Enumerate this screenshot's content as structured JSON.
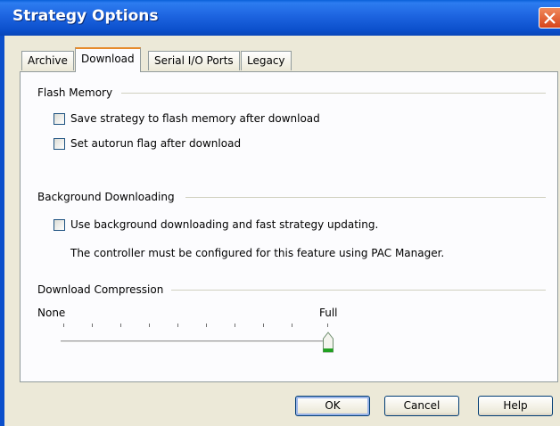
{
  "window": {
    "title": "Strategy Options"
  },
  "tabs": [
    {
      "label": "Archive",
      "active": false
    },
    {
      "label": "Download",
      "active": true
    },
    {
      "label": "Serial I/O Ports",
      "active": false
    },
    {
      "label": "Legacy",
      "active": false
    }
  ],
  "flash_memory": {
    "title": "Flash Memory",
    "options": [
      {
        "label": "Save strategy to flash memory after download",
        "checked": false
      },
      {
        "label": "Set autorun flag after download",
        "checked": false
      }
    ]
  },
  "background_downloading": {
    "title": "Background Downloading",
    "option": {
      "label": "Use background downloading and fast strategy updating.",
      "checked": false
    },
    "note": "The controller must be configured for this feature using PAC Manager."
  },
  "download_compression": {
    "title": "Download Compression",
    "min_label": "None",
    "max_label": "Full",
    "value": 1.0
  },
  "buttons": {
    "ok": "OK",
    "cancel": "Cancel",
    "help": "Help"
  },
  "colors": {
    "titlebar": "#0a5fd9",
    "close": "#d6441a",
    "dialog_bg": "#ece9d8",
    "tab_highlight": "#e68b2c"
  }
}
